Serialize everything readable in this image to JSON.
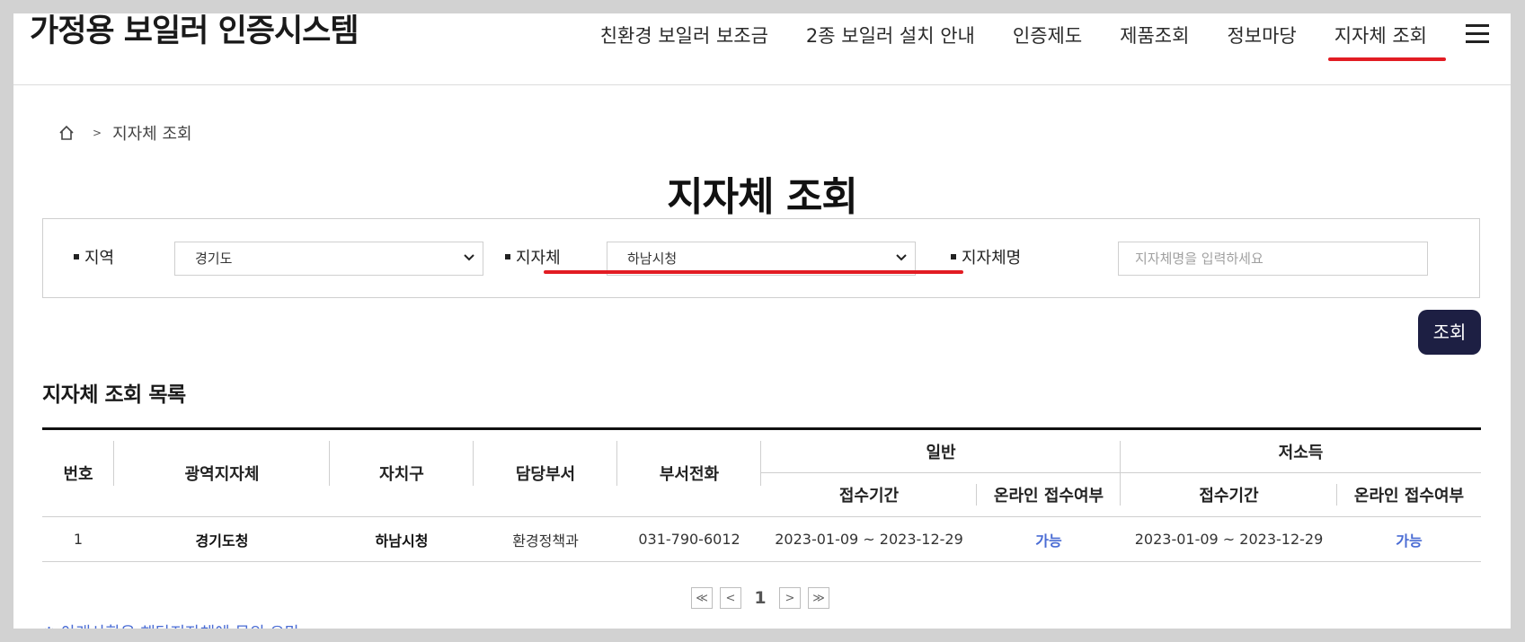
{
  "header": {
    "logo": "가정용 보일러 인증시스템",
    "nav": [
      {
        "label": "친환경 보일러 보조금"
      },
      {
        "label": "2종 보일러 설치 안내"
      },
      {
        "label": "인증제도"
      },
      {
        "label": "제품조회"
      },
      {
        "label": "정보마당"
      },
      {
        "label": "지자체 조회",
        "active": true
      }
    ]
  },
  "breadcrumb": {
    "separator": ">",
    "current": "지자체 조회"
  },
  "page_title": "지자체 조회",
  "search": {
    "region_label": "지역",
    "region_value": "경기도",
    "municipality_label": "지자체",
    "municipality_value": "하남시청",
    "name_label": "지자체명",
    "name_placeholder": "지자체명을 입력하세요",
    "button_label": "조회"
  },
  "list": {
    "title": "지자체 조회 목록",
    "headers": {
      "number": "번호",
      "province": "광역지자체",
      "district": "자치구",
      "department": "담당부서",
      "phone": "부서전화",
      "general": "일반",
      "low_income": "저소득",
      "period": "접수기간",
      "online": "온라인 접수여부"
    },
    "rows": [
      {
        "number": "1",
        "province": "경기도청",
        "district": "하남시청",
        "department": "환경정책과",
        "phone": "031-790-6012",
        "general_period": "2023-01-09 ~ 2023-12-29",
        "general_online": "가능",
        "low_period": "2023-01-09 ~ 2023-12-29",
        "low_online": "가능"
      }
    ]
  },
  "pagination": {
    "first": "≪",
    "prev": "<",
    "current": "1",
    "next": ">",
    "last": "≫"
  },
  "notice": "※ 아래사항은 해당지자체에 문의 요망",
  "colors": {
    "accent_red": "#e21c23",
    "button_navy": "#1d1f43",
    "link_blue": "#4a6cd4"
  }
}
